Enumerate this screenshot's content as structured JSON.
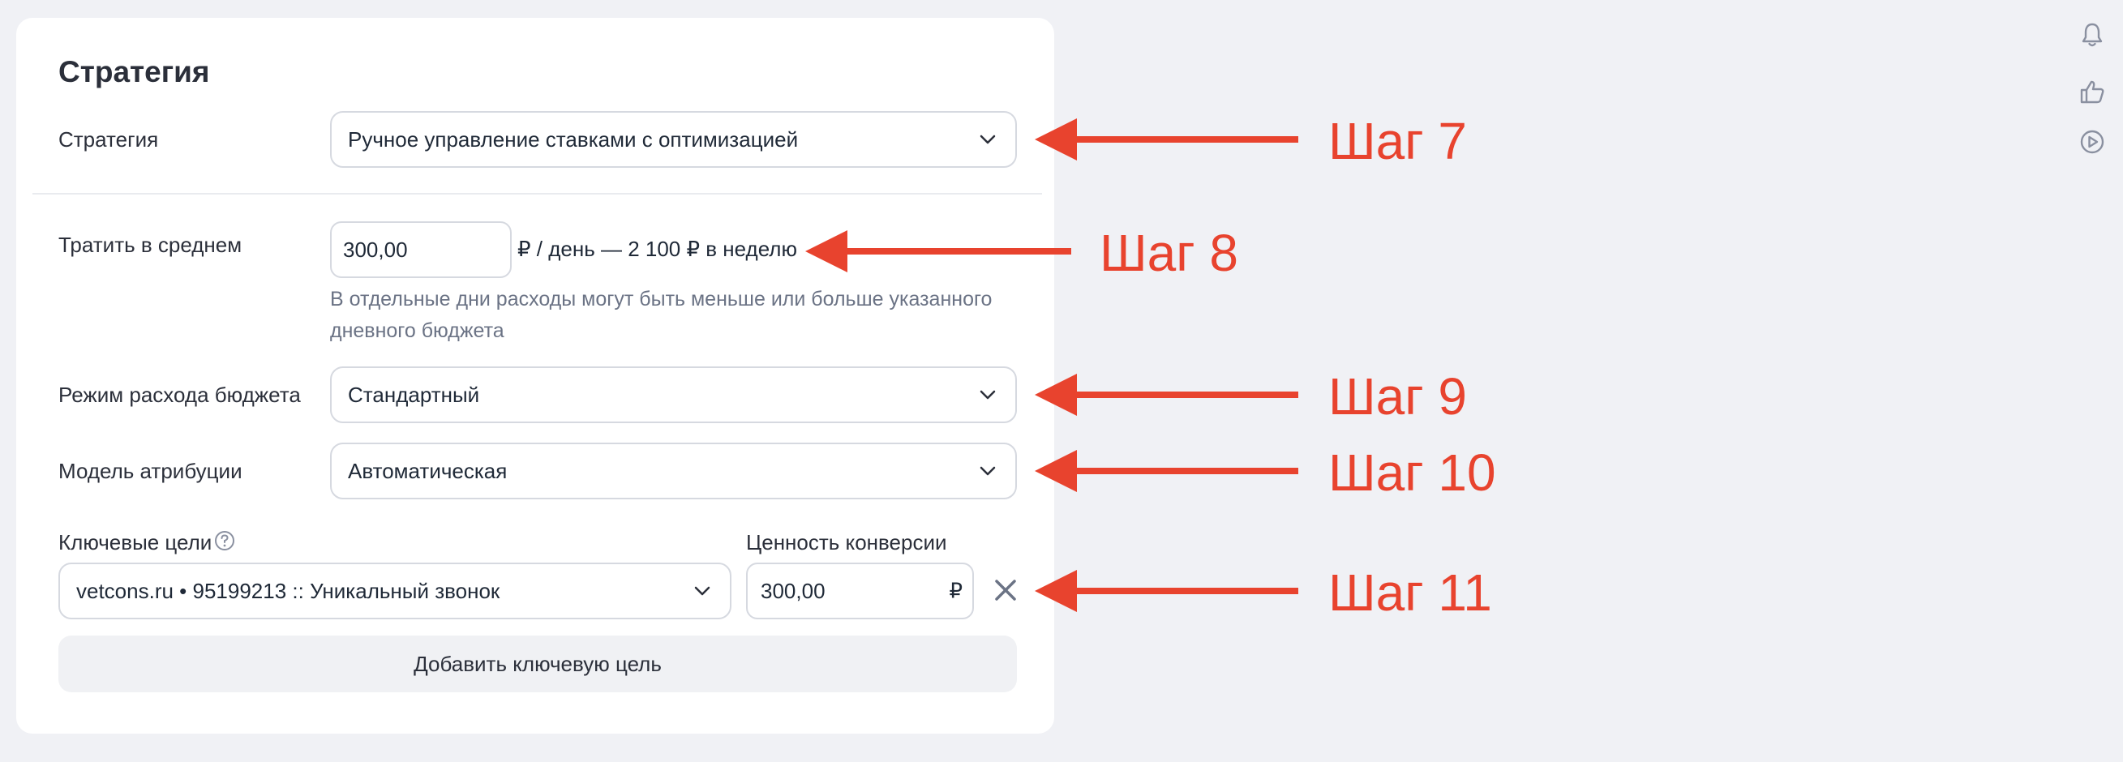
{
  "strategy_card": {
    "title": "Стратегия",
    "strategy": {
      "label": "Стратегия",
      "value": "Ручное управление ставками с оптимизацией"
    },
    "spend": {
      "label": "Тратить в среднем",
      "value": "300,00",
      "suffix": "₽ / день — 2 100 ₽ в неделю",
      "hint": "В отдельные дни расходы могут быть меньше или больше указанного дневного бюджета"
    },
    "budget_mode": {
      "label": "Режим расхода бюджета",
      "value": "Стандартный"
    },
    "attribution": {
      "label": "Модель атрибуции",
      "value": "Автоматическая"
    },
    "key_goals": {
      "label": "Ключевые цели",
      "goal_value": "vetcons.ru • 95199213 :: Уникальный звонок",
      "conversion_label": "Ценность конверсии",
      "conversion_value": "300,00",
      "currency": "₽"
    },
    "add_goal_label": "Добавить ключевую цель"
  },
  "annotations": {
    "step7": "Шаг 7",
    "step8": "Шаг 8",
    "step9": "Шаг 9",
    "step10": "Шаг 10",
    "step11": "Шаг 11",
    "color": "#e8432e"
  },
  "right_rail": {
    "icons": [
      "bell-icon",
      "thumbs-up-icon",
      "play-circle-icon"
    ]
  }
}
